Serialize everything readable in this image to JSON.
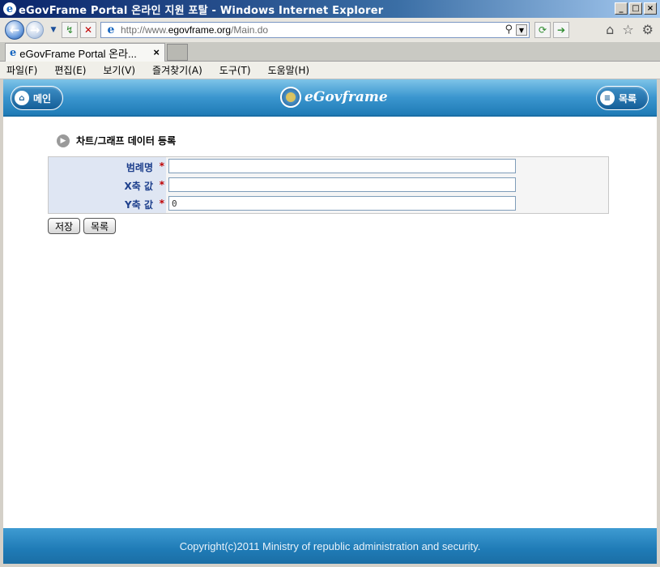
{
  "window": {
    "title": "eGovFrame Portal 온라인 지원 포탈 - Windows Internet Explorer",
    "minimize": "_",
    "maximize": "□",
    "close": "×"
  },
  "address_bar": {
    "url_prefix": "http://www.",
    "url_host": "egovframe.org",
    "url_path": "/Main.do"
  },
  "tab": {
    "label": "eGovFrame Portal 온라...",
    "close": "×"
  },
  "menu": [
    "파일(F)",
    "편집(E)",
    "보기(V)",
    "즐겨찾기(A)",
    "도구(T)",
    "도움말(H)"
  ],
  "header": {
    "main_button": "메인",
    "logo_text": "eGovframe",
    "list_button": "목록"
  },
  "section": {
    "title": "차트/그래프 데이터 등록"
  },
  "form": {
    "rows": [
      {
        "label": "범례명",
        "required": "*",
        "value": ""
      },
      {
        "label": "X축 값",
        "required": "*",
        "value": ""
      },
      {
        "label": "Y축 값",
        "required": "*",
        "value": "0"
      }
    ]
  },
  "buttons": {
    "save": "저장",
    "list": "목록"
  },
  "footer": {
    "copyright": "Copyright(c)2011 Ministry of republic administration and security."
  }
}
